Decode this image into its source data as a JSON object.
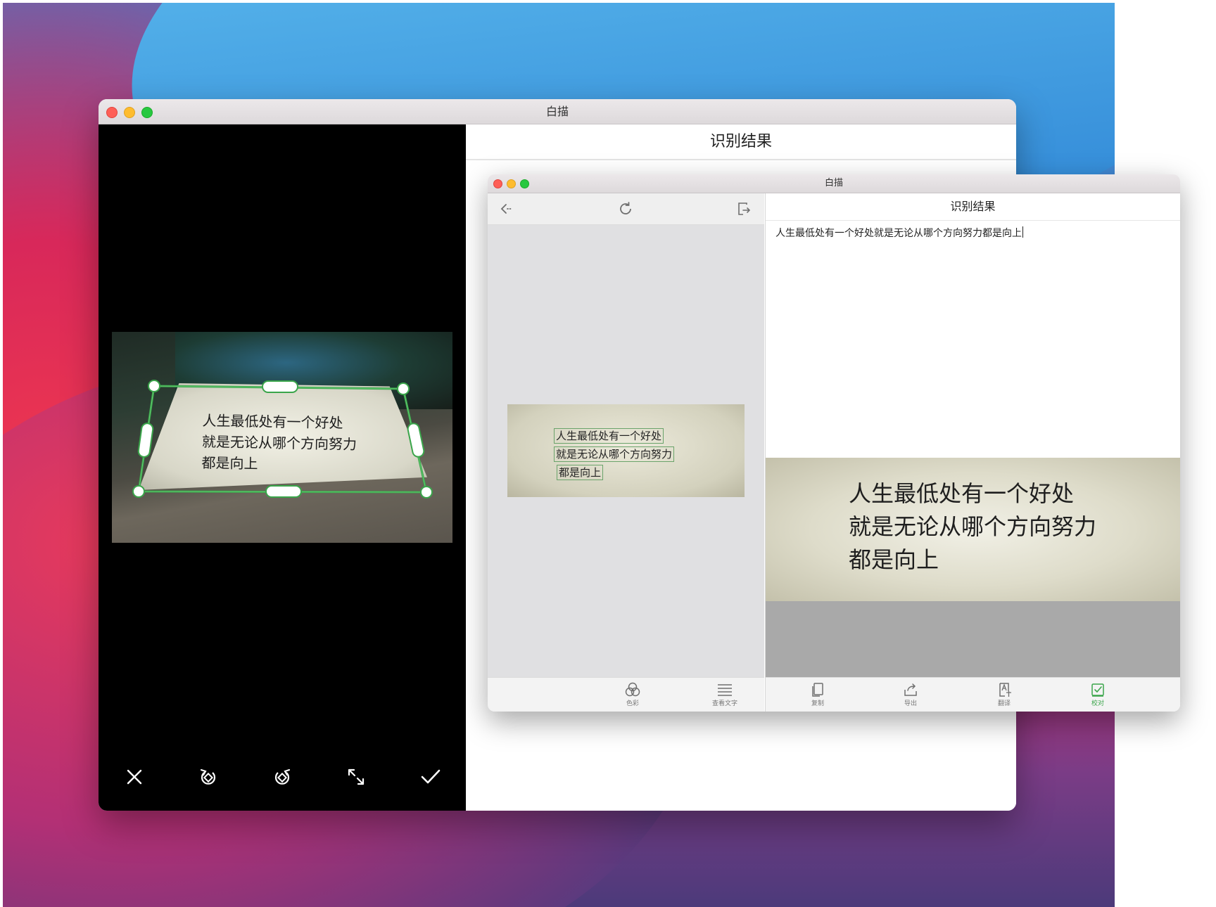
{
  "colors": {
    "accent_green": "#3aa54a",
    "icon_gray": "#6f6f6f",
    "handwriting": "#1e1e1e"
  },
  "main_window": {
    "title": "白描",
    "traffic_lights": [
      "close",
      "minimize",
      "zoom"
    ],
    "camera_panel": {
      "handwriting_lines": [
        "人生最低处有一个好处",
        "就是无论从哪个方向努力",
        "都是向上"
      ],
      "toolbar": [
        {
          "name": "cancel",
          "icon": "close-icon"
        },
        {
          "name": "rotate-left",
          "icon": "rotate-left-icon"
        },
        {
          "name": "rotate-right",
          "icon": "rotate-right-icon"
        },
        {
          "name": "expand",
          "icon": "expand-icon"
        },
        {
          "name": "confirm",
          "icon": "check-icon"
        }
      ]
    },
    "result_title": "识别结果"
  },
  "front_window": {
    "title": "白描",
    "left_toolbar": {
      "back_icon": "back-arrow-icon",
      "refresh_icon": "refresh-icon",
      "export_icon": "export-image-icon"
    },
    "thumbnail_lines": [
      "人生最低处有一个好处",
      "就是无论从哪个方向努力",
      "都是向上"
    ],
    "left_bottom_buttons": [
      {
        "label": "色彩",
        "icon": "color-icon"
      },
      {
        "label": "查看文字",
        "icon": "text-lines-icon"
      }
    ],
    "result_title": "识别结果",
    "ocr_text": "人生最低处有一个好处就是无论从哪个方向努力都是向上",
    "preview_lines": [
      "人生最低处有一个好处",
      "就是无论从哪个方向努力",
      "都是向上"
    ],
    "right_bottom_buttons": [
      {
        "label": "复制",
        "icon": "copy-icon"
      },
      {
        "label": "导出",
        "icon": "share-icon"
      },
      {
        "label": "翻译",
        "icon": "translate-icon"
      },
      {
        "label": "校对",
        "icon": "proofread-icon",
        "active": true
      }
    ]
  }
}
